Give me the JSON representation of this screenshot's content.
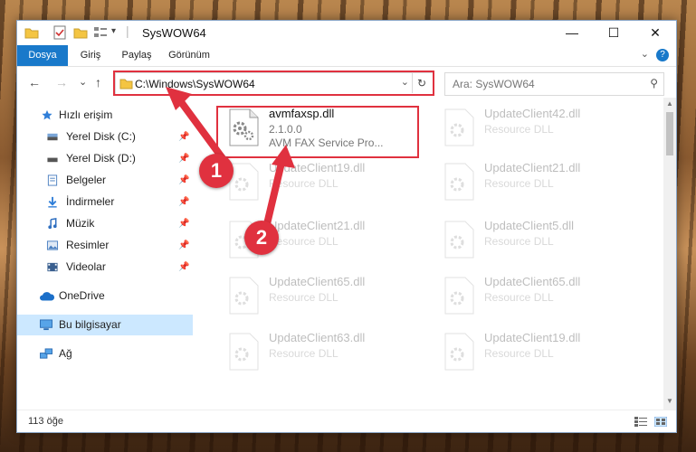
{
  "window": {
    "title": "SysWOW64",
    "qa_down": "▾",
    "controls": {
      "minimize": "—",
      "maximize": "☐",
      "close": "✕"
    }
  },
  "ribbon": {
    "tabs": [
      {
        "label": "Dosya",
        "active": true
      },
      {
        "label": "Giriş"
      },
      {
        "label": "Paylaş"
      },
      {
        "label": "Görünüm"
      }
    ],
    "expand": "⌄",
    "help": "?"
  },
  "nav": {
    "back": "←",
    "forward": "→",
    "recent": "⌄",
    "up": "↑",
    "address": "C:\\Windows\\SysWOW64",
    "address_drop": "⌄",
    "refresh": "↻",
    "search_placeholder": "Ara: SysWOW64",
    "search_icon": "⚲"
  },
  "sidebar": {
    "pin": "📌",
    "items": [
      {
        "label": "Hızlı erişim",
        "icon": "star-icon"
      },
      {
        "label": "Yerel Disk (C:)",
        "icon": "drive-icon",
        "pinned": true
      },
      {
        "label": "Yerel Disk (D:)",
        "icon": "drive-icon",
        "pinned": true
      },
      {
        "label": "Belgeler",
        "icon": "documents-icon",
        "pinned": true
      },
      {
        "label": "İndirmeler",
        "icon": "download-icon",
        "pinned": true
      },
      {
        "label": "Müzik",
        "icon": "music-icon",
        "pinned": true
      },
      {
        "label": "Resimler",
        "icon": "pictures-icon",
        "pinned": true
      },
      {
        "label": "Videolar",
        "icon": "videos-icon",
        "pinned": true
      },
      {
        "label": "OneDrive",
        "icon": "cloud-icon"
      },
      {
        "label": "Bu bilgisayar",
        "icon": "computer-icon",
        "selected": true
      },
      {
        "label": "Ağ",
        "icon": "network-icon"
      }
    ]
  },
  "files": {
    "highlighted": {
      "name": "avmfaxsp.dll",
      "version": "2.1.0.0",
      "description": "AVM FAX Service Pro..."
    },
    "others": [
      {
        "name": "UpdateClient42.dll",
        "description": "Resource DLL"
      },
      {
        "name": "UpdateClient19.dll",
        "description": "Resource DLL"
      },
      {
        "name": "UpdateClient21.dll",
        "description": "Resource DLL"
      },
      {
        "name": "UpdateClient21.dll",
        "description": "Resource DLL"
      },
      {
        "name": "UpdateClient5.dll",
        "description": "Resource DLL"
      },
      {
        "name": "UpdateClient65.dll",
        "description": "Resource DLL"
      },
      {
        "name": "UpdateClient65.dll",
        "description": "Resource DLL"
      },
      {
        "name": "UpdateClient63.dll",
        "description": "Resource DLL"
      },
      {
        "name": "UpdateClient19.dll",
        "description": "Resource DLL"
      }
    ]
  },
  "scroll": {
    "up": "▲",
    "down": "▼"
  },
  "status": {
    "count": "113 öğe"
  },
  "callouts": {
    "one": "1",
    "two": "2"
  },
  "colors": {
    "accent": "#1979ca",
    "highlight": "#e0313f",
    "selected": "#cce8ff",
    "folder": "#f4c542"
  }
}
